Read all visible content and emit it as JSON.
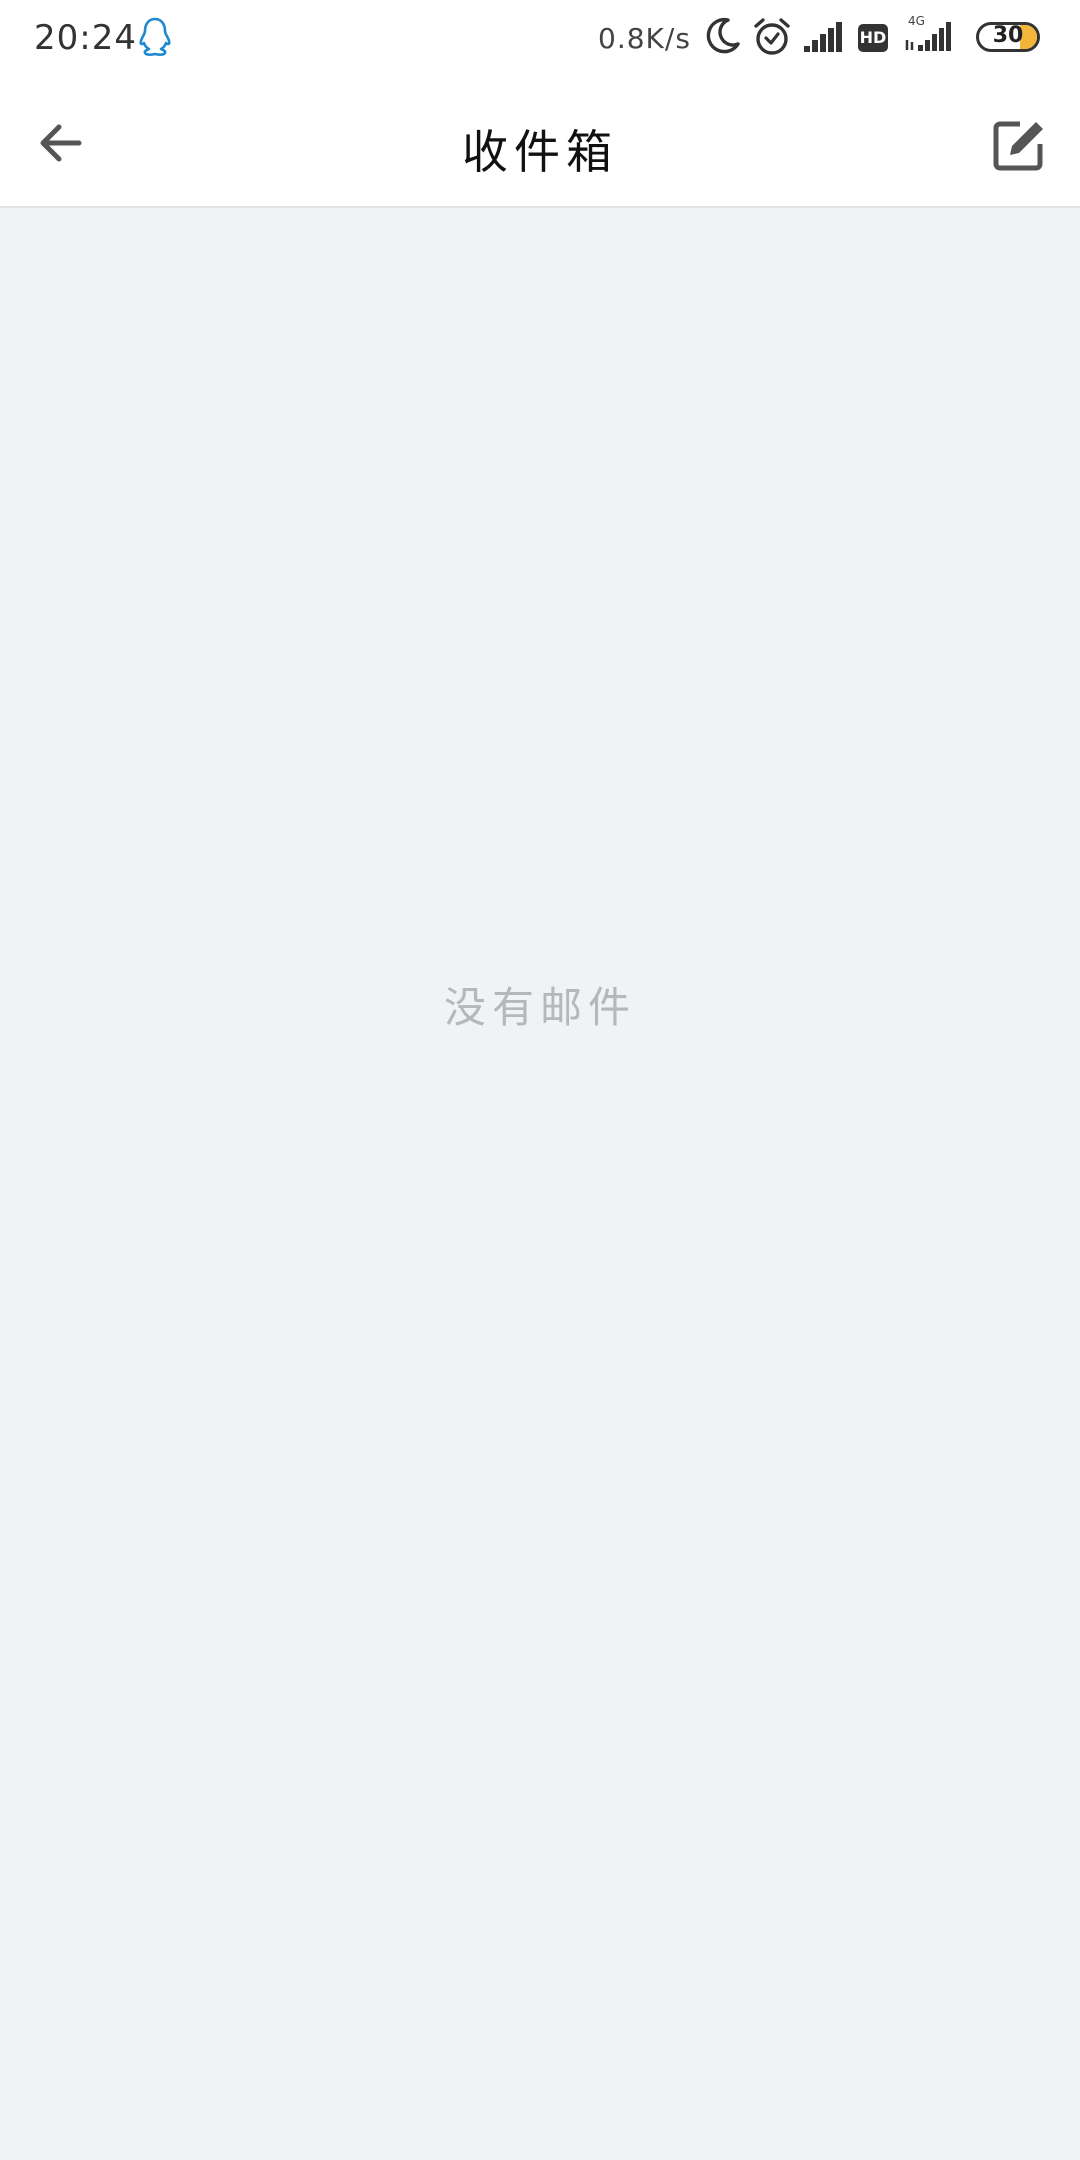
{
  "status_bar": {
    "time": "20:24",
    "network_speed": "0.8K/s",
    "battery_level": "30",
    "battery_percent": 30,
    "network_type": "4G",
    "hd_badge": "HD",
    "icons": [
      "qq-icon",
      "moon-icon",
      "alarm-icon",
      "signal-icon",
      "hd-icon",
      "signal-4g-icon",
      "battery-icon"
    ]
  },
  "header": {
    "title": "收件箱",
    "back_icon": "arrow-left-icon",
    "compose_icon": "edit-icon"
  },
  "main": {
    "empty_message": "没有邮件"
  },
  "colors": {
    "background": "#f1f2f6",
    "header_background": "#ffffff",
    "empty_text": "#b5b7bb",
    "battery_fill": "#f4b53b",
    "qq_icon": "#1e88d0"
  }
}
